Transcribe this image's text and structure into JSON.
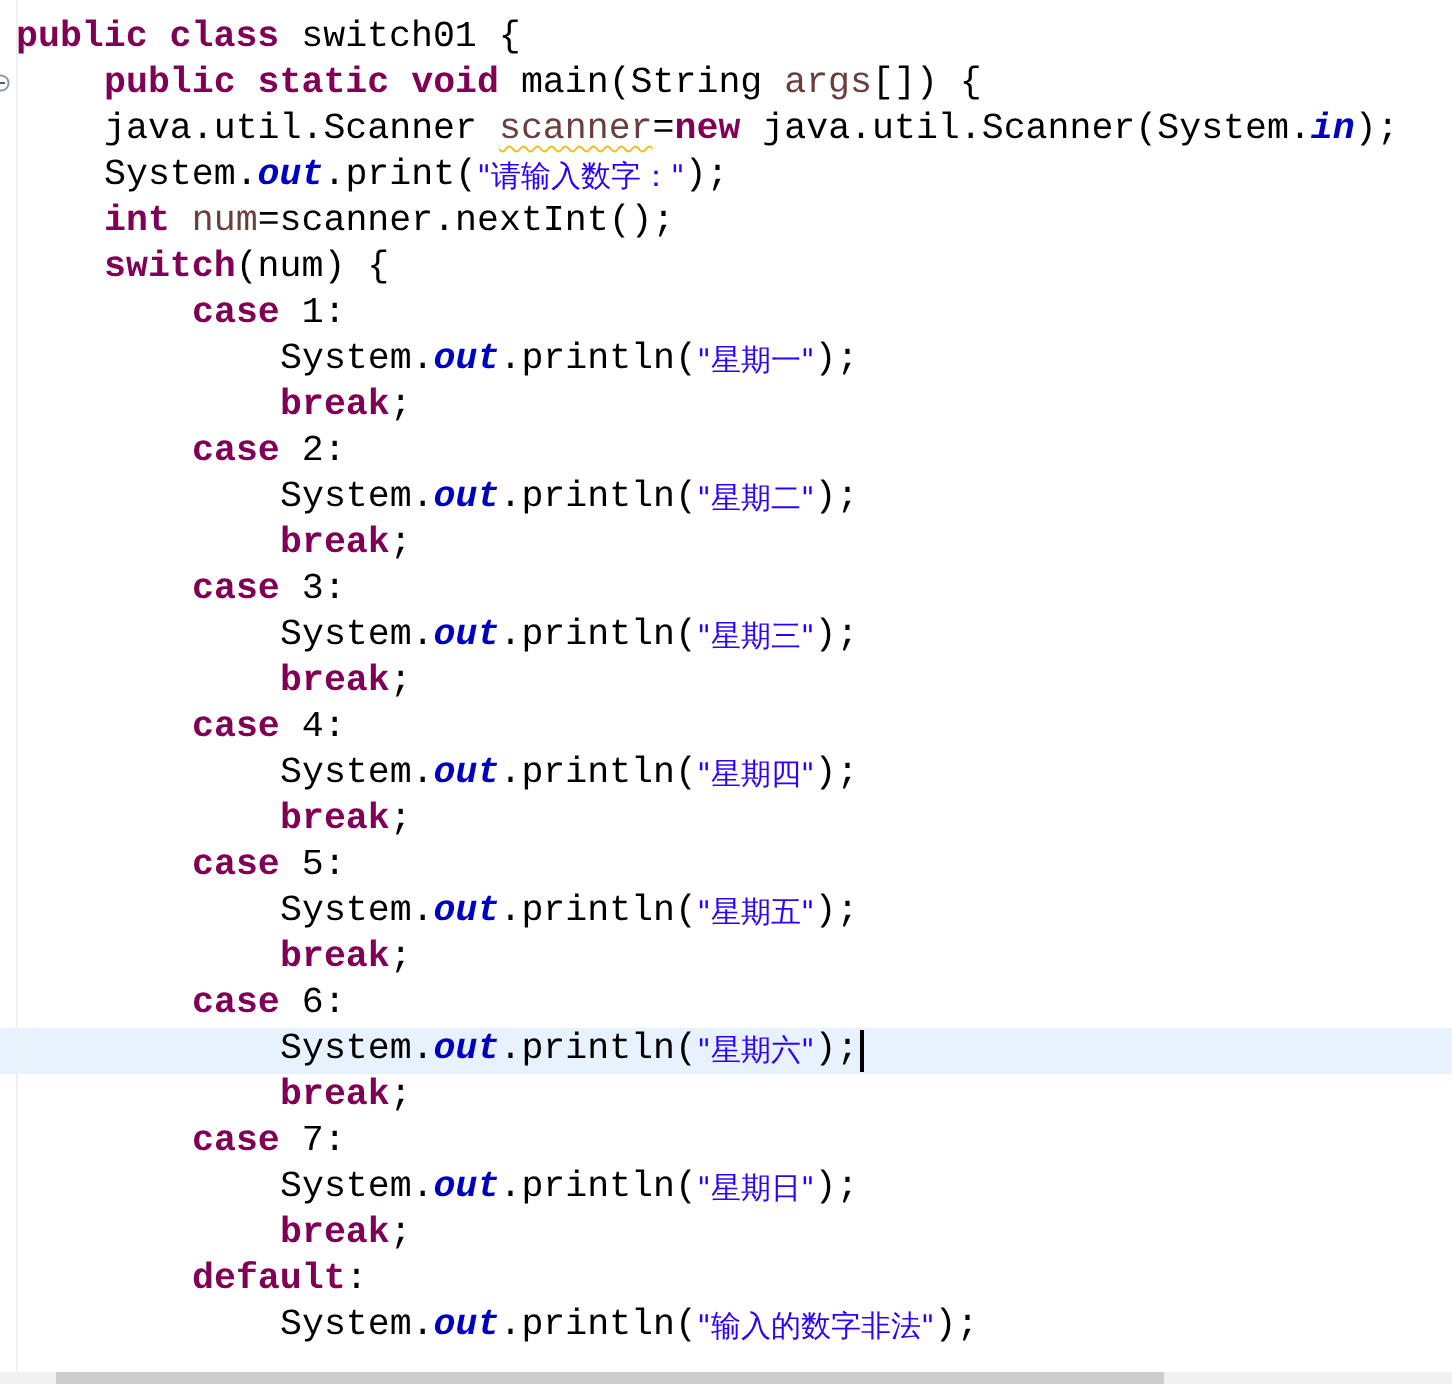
{
  "editor": {
    "lines": [
      {
        "current": false,
        "tokens": [
          {
            "kind": "keyword",
            "text": "public "
          },
          {
            "kind": "keyword",
            "text": "class"
          },
          {
            "kind": "plain",
            "text": " switch01 {"
          }
        ],
        "children": [
          {
            "current": false,
            "tokens": [
              {
                "kind": "keyword",
                "text": "public "
              },
              {
                "kind": "keyword",
                "text": "static "
              },
              {
                "kind": "keyword",
                "text": "void"
              },
              {
                "kind": "plain",
                "text": " main(String "
              },
              {
                "kind": "variable",
                "text": "args"
              },
              {
                "kind": "plain",
                "text": "[]) {"
              }
            ]
          },
          {
            "current": false,
            "tokens": [
              {
                "kind": "plain",
                "text": "java.util.Scanner "
              },
              {
                "kind": "warning-variable",
                "text": "scanner"
              },
              {
                "kind": "plain",
                "text": "="
              },
              {
                "kind": "keyword",
                "text": "new"
              },
              {
                "kind": "plain",
                "text": " java.util.Scanner(System."
              },
              {
                "kind": "field",
                "text": "in"
              },
              {
                "kind": "plain",
                "text": ");"
              }
            ]
          },
          {
            "current": false,
            "tokens": [
              {
                "kind": "plain",
                "text": "System."
              },
              {
                "kind": "field",
                "text": "out"
              },
              {
                "kind": "plain",
                "text": ".print("
              },
              {
                "kind": "string",
                "text": "\"请输入数字：\""
              },
              {
                "kind": "plain",
                "text": ");"
              }
            ]
          },
          {
            "current": false,
            "tokens": [
              {
                "kind": "keyword",
                "text": "int "
              },
              {
                "kind": "variable",
                "text": "num"
              },
              {
                "kind": "plain",
                "text": "=scanner.nextInt();"
              }
            ]
          },
          {
            "current": false,
            "tokens": [
              {
                "kind": "keyword",
                "text": "switch"
              },
              {
                "kind": "plain",
                "text": "(num) {"
              }
            ],
            "children": [
              {
                "current": false,
                "tokens": [
                  {
                    "kind": "keyword",
                    "text": "case"
                  },
                  {
                    "kind": "plain",
                    "text": " 1:"
                  }
                ],
                "children": [
                  {
                    "current": false,
                    "tokens": [
                      {
                        "kind": "plain",
                        "text": "System."
                      },
                      {
                        "kind": "field",
                        "text": "out"
                      },
                      {
                        "kind": "plain",
                        "text": ".println("
                      },
                      {
                        "kind": "string",
                        "text": "\"星期一\""
                      },
                      {
                        "kind": "plain",
                        "text": ");"
                      }
                    ]
                  },
                  {
                    "current": false,
                    "tokens": [
                      {
                        "kind": "keyword",
                        "text": "break"
                      },
                      {
                        "kind": "plain",
                        "text": ";"
                      }
                    ]
                  }
                ]
              },
              {
                "current": false,
                "tokens": [
                  {
                    "kind": "keyword",
                    "text": "case"
                  },
                  {
                    "kind": "plain",
                    "text": " 2:"
                  }
                ],
                "children": [
                  {
                    "current": false,
                    "tokens": [
                      {
                        "kind": "plain",
                        "text": "System."
                      },
                      {
                        "kind": "field",
                        "text": "out"
                      },
                      {
                        "kind": "plain",
                        "text": ".println("
                      },
                      {
                        "kind": "string",
                        "text": "\"星期二\""
                      },
                      {
                        "kind": "plain",
                        "text": ");"
                      }
                    ]
                  },
                  {
                    "current": false,
                    "tokens": [
                      {
                        "kind": "keyword",
                        "text": "break"
                      },
                      {
                        "kind": "plain",
                        "text": ";"
                      }
                    ]
                  }
                ]
              },
              {
                "current": false,
                "tokens": [
                  {
                    "kind": "keyword",
                    "text": "case"
                  },
                  {
                    "kind": "plain",
                    "text": " 3:"
                  }
                ],
                "children": [
                  {
                    "current": false,
                    "tokens": [
                      {
                        "kind": "plain",
                        "text": "System."
                      },
                      {
                        "kind": "field",
                        "text": "out"
                      },
                      {
                        "kind": "plain",
                        "text": ".println("
                      },
                      {
                        "kind": "string",
                        "text": "\"星期三\""
                      },
                      {
                        "kind": "plain",
                        "text": ");"
                      }
                    ]
                  },
                  {
                    "current": false,
                    "tokens": [
                      {
                        "kind": "keyword",
                        "text": "break"
                      },
                      {
                        "kind": "plain",
                        "text": ";"
                      }
                    ]
                  }
                ]
              },
              {
                "current": false,
                "tokens": [
                  {
                    "kind": "keyword",
                    "text": "case"
                  },
                  {
                    "kind": "plain",
                    "text": " 4:"
                  }
                ],
                "children": [
                  {
                    "current": false,
                    "tokens": [
                      {
                        "kind": "plain",
                        "text": "System."
                      },
                      {
                        "kind": "field",
                        "text": "out"
                      },
                      {
                        "kind": "plain",
                        "text": ".println("
                      },
                      {
                        "kind": "string",
                        "text": "\"星期四\""
                      },
                      {
                        "kind": "plain",
                        "text": ");"
                      }
                    ]
                  },
                  {
                    "current": false,
                    "tokens": [
                      {
                        "kind": "keyword",
                        "text": "break"
                      },
                      {
                        "kind": "plain",
                        "text": ";"
                      }
                    ]
                  }
                ]
              },
              {
                "current": false,
                "tokens": [
                  {
                    "kind": "keyword",
                    "text": "case"
                  },
                  {
                    "kind": "plain",
                    "text": " 5:"
                  }
                ],
                "children": [
                  {
                    "current": false,
                    "tokens": [
                      {
                        "kind": "plain",
                        "text": "System."
                      },
                      {
                        "kind": "field",
                        "text": "out"
                      },
                      {
                        "kind": "plain",
                        "text": ".println("
                      },
                      {
                        "kind": "string",
                        "text": "\"星期五\""
                      },
                      {
                        "kind": "plain",
                        "text": ");"
                      }
                    ]
                  },
                  {
                    "current": false,
                    "tokens": [
                      {
                        "kind": "keyword",
                        "text": "break"
                      },
                      {
                        "kind": "plain",
                        "text": ";"
                      }
                    ]
                  }
                ]
              },
              {
                "current": false,
                "tokens": [
                  {
                    "kind": "keyword",
                    "text": "case"
                  },
                  {
                    "kind": "plain",
                    "text": " 6:"
                  }
                ],
                "children": [
                  {
                    "current": true,
                    "tokens": [
                      {
                        "kind": "plain",
                        "text": "System."
                      },
                      {
                        "kind": "field",
                        "text": "out"
                      },
                      {
                        "kind": "plain",
                        "text": ".println("
                      },
                      {
                        "kind": "string",
                        "text": "\"星期六\""
                      },
                      {
                        "kind": "plain",
                        "text": ");"
                      }
                    ]
                  },
                  {
                    "current": false,
                    "tokens": [
                      {
                        "kind": "keyword",
                        "text": "break"
                      },
                      {
                        "kind": "plain",
                        "text": ";"
                      }
                    ]
                  }
                ]
              },
              {
                "current": false,
                "tokens": [
                  {
                    "kind": "keyword",
                    "text": "case"
                  },
                  {
                    "kind": "plain",
                    "text": " 7:"
                  }
                ],
                "children": [
                  {
                    "current": false,
                    "tokens": [
                      {
                        "kind": "plain",
                        "text": "System."
                      },
                      {
                        "kind": "field",
                        "text": "out"
                      },
                      {
                        "kind": "plain",
                        "text": ".println("
                      },
                      {
                        "kind": "string",
                        "text": "\"星期日\""
                      },
                      {
                        "kind": "plain",
                        "text": ");"
                      }
                    ]
                  },
                  {
                    "current": false,
                    "tokens": [
                      {
                        "kind": "keyword",
                        "text": "break"
                      },
                      {
                        "kind": "plain",
                        "text": ";"
                      }
                    ]
                  }
                ]
              },
              {
                "current": false,
                "tokens": [
                  {
                    "kind": "keyword",
                    "text": "default"
                  },
                  {
                    "kind": "plain",
                    "text": ":"
                  }
                ],
                "children": [
                  {
                    "current": false,
                    "tokens": [
                      {
                        "kind": "plain",
                        "text": "System."
                      },
                      {
                        "kind": "field",
                        "text": "out"
                      },
                      {
                        "kind": "plain",
                        "text": ".println("
                      },
                      {
                        "kind": "string",
                        "text": "\"输入的数字非法\""
                      },
                      {
                        "kind": "plain",
                        "text": ");"
                      }
                    ]
                  }
                ]
              }
            ]
          }
        ]
      }
    ]
  }
}
